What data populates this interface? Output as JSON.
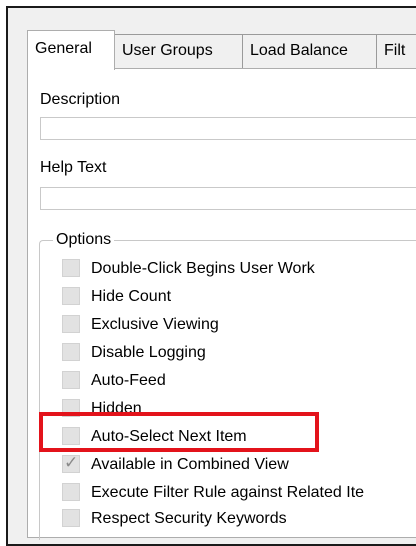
{
  "tabs": [
    {
      "label": "General",
      "active": true
    },
    {
      "label": "User Groups",
      "active": false
    },
    {
      "label": "Load Balance",
      "active": false
    },
    {
      "label": "Filt",
      "active": false
    }
  ],
  "fields": {
    "description_label": "Description",
    "description_value": "",
    "help_text_label": "Help Text",
    "help_text_value": ""
  },
  "options": {
    "title": "Options",
    "items": [
      {
        "label": "Double-Click Begins User Work",
        "checked": false
      },
      {
        "label": "Hide Count",
        "checked": false
      },
      {
        "label": "Exclusive Viewing",
        "checked": false
      },
      {
        "label": "Disable Logging",
        "checked": false
      },
      {
        "label": "Auto-Feed",
        "checked": false
      },
      {
        "label": "Hidden",
        "checked": false
      },
      {
        "label": "Auto-Select Next Item",
        "checked": false
      },
      {
        "label": "Available in Combined View",
        "checked": true
      },
      {
        "label": "Execute Filter Rule against Related Ite",
        "checked": false
      },
      {
        "label": "Respect Security Keywords",
        "checked": false
      }
    ]
  },
  "highlight_color": "#e3131b",
  "check_mark": "✓"
}
